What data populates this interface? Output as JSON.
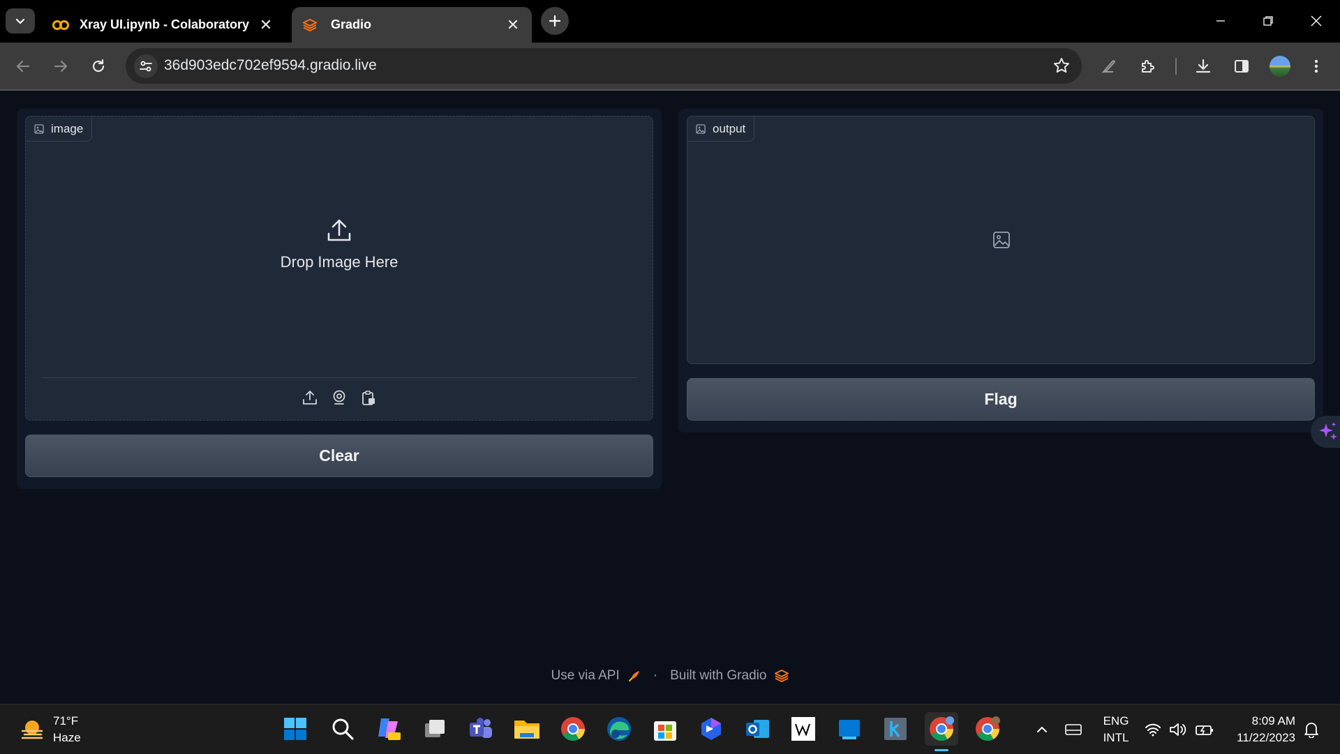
{
  "browser": {
    "tabs": [
      {
        "title": "Xray UI.ipynb - Colaboratory",
        "favicon": "colab-icon",
        "active": false
      },
      {
        "title": "Gradio",
        "favicon": "gradio-icon",
        "active": true
      }
    ],
    "url": "36d903edc702ef9594.gradio.live"
  },
  "app": {
    "input_label": "image",
    "drop_text": "Drop Image Here",
    "output_label": "output",
    "clear_label": "Clear",
    "flag_label": "Flag"
  },
  "footer": {
    "api_text": "Use via API",
    "separator": "·",
    "built_text": "Built with Gradio"
  },
  "taskbar": {
    "temperature": "71°F",
    "condition": "Haze",
    "lang_line1": "ENG",
    "lang_line2": "INTL",
    "time": "8:09 AM",
    "date": "11/22/2023"
  },
  "colors": {
    "page_bg": "#0b0f19",
    "panel_bg": "#111827",
    "block_bg": "#1f2937",
    "button_bg": "#4b5563",
    "gradio_orange": "#f97316"
  }
}
